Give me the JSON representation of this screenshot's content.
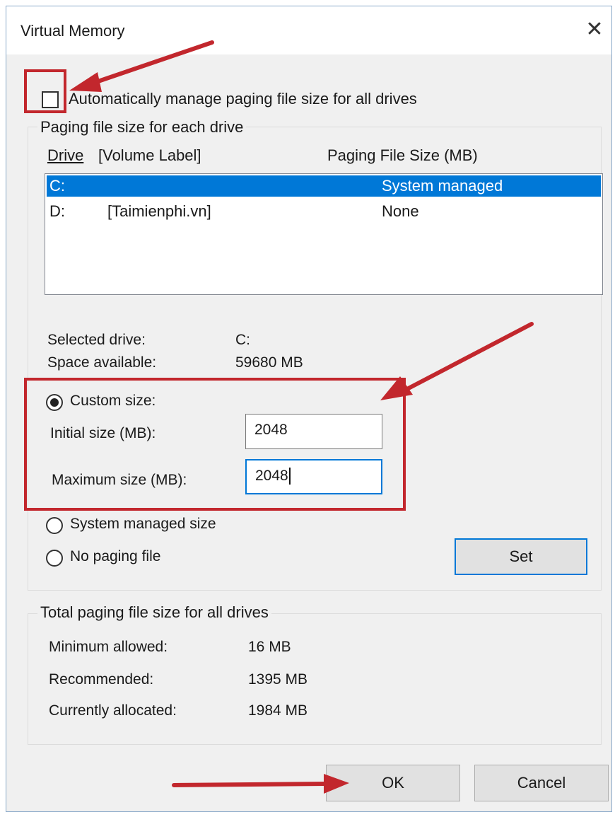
{
  "window": {
    "title": "Virtual Memory",
    "close_glyph": "✕"
  },
  "auto_manage": {
    "label": "Automatically manage paging file size for all drives",
    "checked": false
  },
  "per_drive": {
    "caption": "Paging file size for each drive",
    "col_drive": "Drive",
    "col_volume": "[Volume Label]",
    "col_size": "Paging File Size (MB)",
    "rows": [
      {
        "drive": "C:",
        "label": "",
        "size": "System managed",
        "selected": true
      },
      {
        "drive": "D:",
        "label": "[Taimienphi.vn]",
        "size": "None",
        "selected": false
      }
    ],
    "selected_drive_label": "Selected drive:",
    "selected_drive_value": "C:",
    "space_label": "Space available:",
    "space_value": "59680 MB",
    "custom_size_label": "Custom size:",
    "initial_label": "Initial size (MB):",
    "initial_value": "2048",
    "maximum_label": "Maximum size (MB):",
    "maximum_value": "2048",
    "system_managed_label": "System managed size",
    "no_paging_label": "No paging file",
    "set_button": "Set",
    "selected_option": "custom"
  },
  "totals": {
    "caption": "Total paging file size for all drives",
    "min_label": "Minimum allowed:",
    "min_value": "16 MB",
    "rec_label": "Recommended:",
    "rec_value": "1395 MB",
    "alloc_label": "Currently allocated:",
    "alloc_value": "1984 MB"
  },
  "buttons": {
    "ok": "OK",
    "cancel": "Cancel"
  },
  "annotation_color": "#c2272d",
  "accent_color": "#0078d7"
}
